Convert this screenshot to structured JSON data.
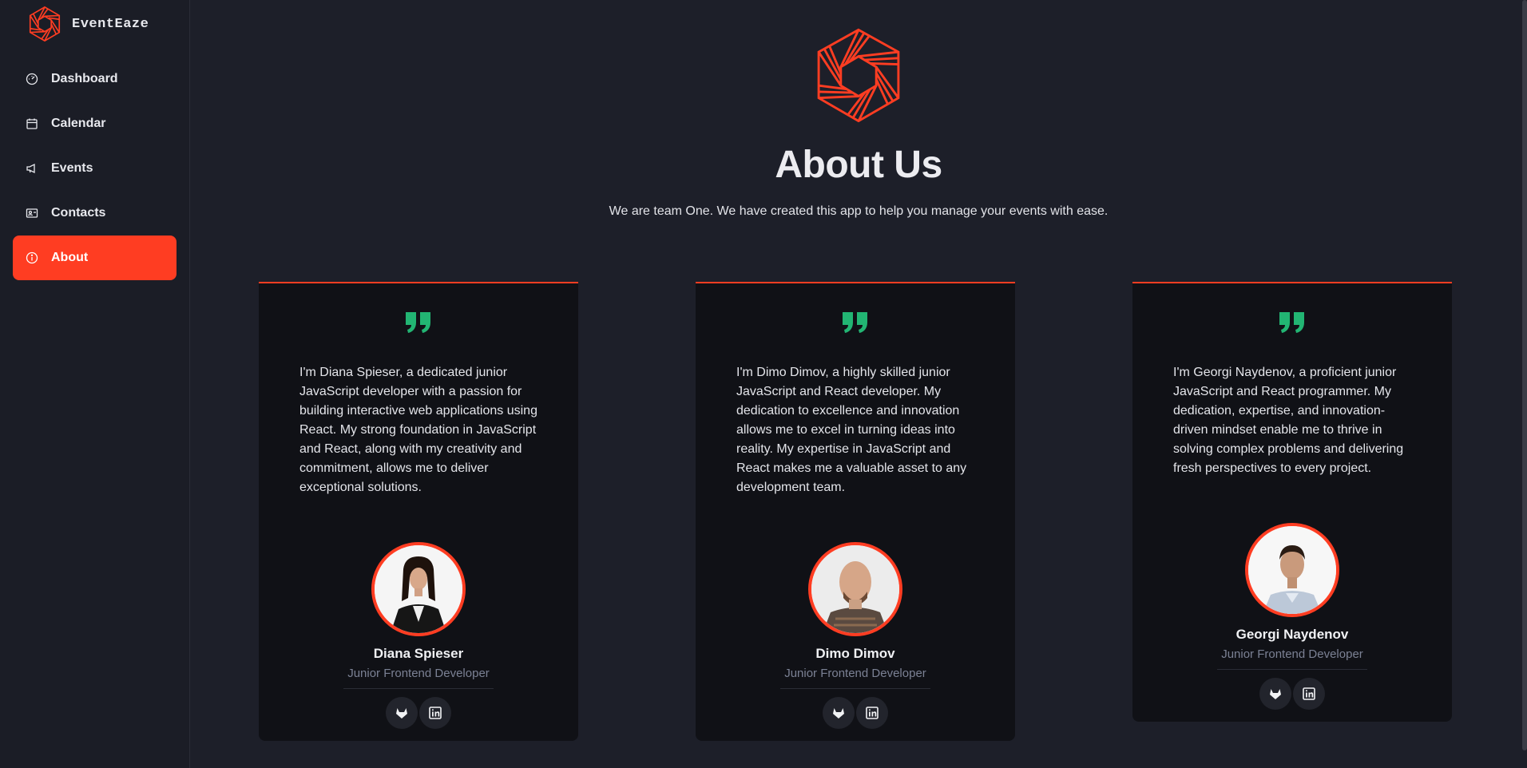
{
  "brand": {
    "name": "EventEaze",
    "accent": "#ff3d22"
  },
  "sidebar": {
    "items": [
      {
        "label": "Dashboard",
        "icon": "gauge-icon",
        "active": false
      },
      {
        "label": "Calendar",
        "icon": "calendar-icon",
        "active": false
      },
      {
        "label": "Events",
        "icon": "megaphone-icon",
        "active": false
      },
      {
        "label": "Contacts",
        "icon": "contact-card-icon",
        "active": false
      },
      {
        "label": "About",
        "icon": "info-icon",
        "active": true
      }
    ]
  },
  "hero": {
    "title": "About Us",
    "subtitle": "We are team One. We have created this app to help you manage your events with ease."
  },
  "team": [
    {
      "quote": "I'm Diana Spieser, a dedicated junior JavaScript developer with a passion for building interactive web applications using React. My strong foundation in JavaScript and React, along with my creativity and commitment, allows me to deliver exceptional solutions.",
      "name": "Diana Spieser",
      "role": "Junior Frontend Developer",
      "socials": [
        "gitlab-icon",
        "linkedin-icon"
      ]
    },
    {
      "quote": "I'm Dimo Dimov, a highly skilled junior JavaScript and React developer. My dedication to excellence and innovation allows me to excel in turning ideas into reality. My expertise in JavaScript and React makes me a valuable asset to any development team.",
      "name": "Dimo Dimov",
      "role": "Junior Frontend Developer",
      "socials": [
        "gitlab-icon",
        "linkedin-icon"
      ]
    },
    {
      "quote": "I'm Georgi Naydenov, a proficient junior JavaScript and React programmer. My dedication, expertise, and innovation-driven mindset enable me to thrive in solving complex problems and delivering fresh perspectives to every project.",
      "name": "Georgi Naydenov",
      "role": "Junior Frontend Developer",
      "socials": [
        "gitlab-icon",
        "linkedin-icon"
      ]
    }
  ],
  "colors": {
    "quote": "#22b573",
    "background": "#1d1f29",
    "card": "#101116"
  }
}
